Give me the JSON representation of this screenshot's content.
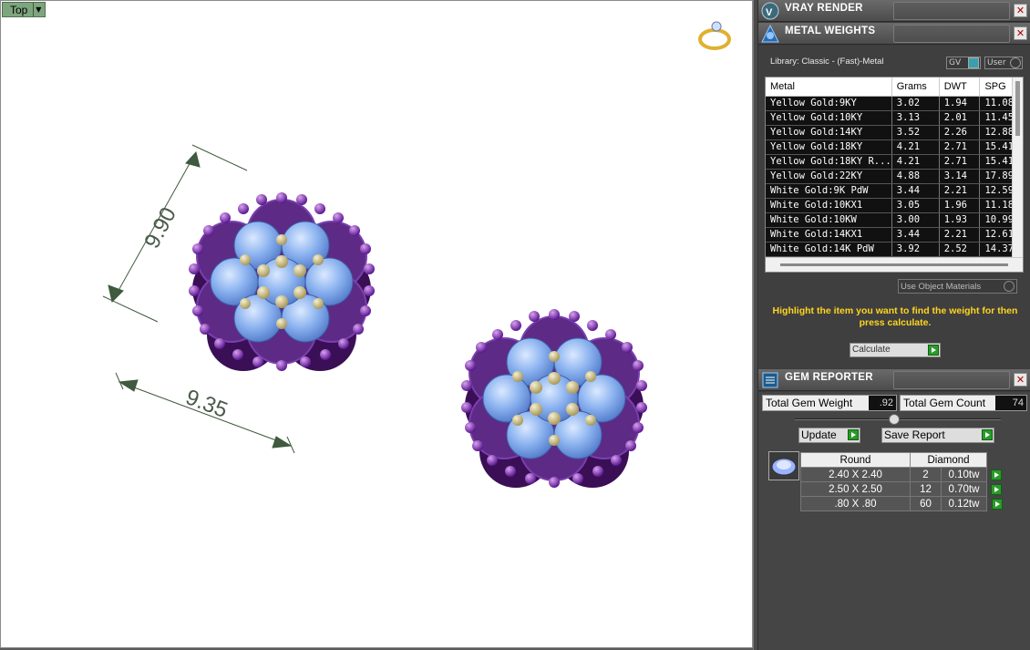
{
  "viewport": {
    "label": "Top",
    "dimensions": [
      "9.90",
      "9.35"
    ]
  },
  "panels": {
    "vray": {
      "title": "VRAY RENDER"
    },
    "metal": {
      "title": "METAL WEIGHTS",
      "library": "Library: Classic - (Fast)-Metal",
      "toggle_gv": "GV",
      "toggle_user": "User",
      "columns": [
        "Metal",
        "Grams",
        "DWT",
        "SPG"
      ],
      "rows": [
        [
          "Yellow Gold:9KY",
          "3.02",
          "1.94",
          "11.08"
        ],
        [
          "Yellow Gold:10KY",
          "3.13",
          "2.01",
          "11.45"
        ],
        [
          "Yellow Gold:14KY",
          "3.52",
          "2.26",
          "12.88"
        ],
        [
          "Yellow Gold:18KY",
          "4.21",
          "2.71",
          "15.41"
        ],
        [
          "Yellow Gold:18KY R...",
          "4.21",
          "2.71",
          "15.41"
        ],
        [
          "Yellow Gold:22KY",
          "4.88",
          "3.14",
          "17.89"
        ],
        [
          "White Gold:9K PdW",
          "3.44",
          "2.21",
          "12.59"
        ],
        [
          "White Gold:10KX1",
          "3.05",
          "1.96",
          "11.18"
        ],
        [
          "White Gold:10KW",
          "3.00",
          "1.93",
          "10.99"
        ],
        [
          "White Gold:14KX1",
          "3.44",
          "2.21",
          "12.61"
        ],
        [
          "White Gold:14K PdW",
          "3.92",
          "2.52",
          "14.37"
        ]
      ],
      "use_object_materials": "Use Object Materials",
      "hint": "Highlight the item you want to find the weight for then press calculate.",
      "calculate": "Calculate"
    },
    "gem": {
      "title": "GEM REPORTER",
      "total_weight_label": "Total Gem Weight",
      "total_weight_value": ".92",
      "total_count_label": "Total Gem Count",
      "total_count_value": "74",
      "update": "Update",
      "save_report": "Save Report",
      "shape": "Round",
      "material": "Diamond",
      "rows": [
        [
          "2.40 X 2.40",
          "2",
          "0.10tw"
        ],
        [
          "2.50 X 2.50",
          "12",
          "0.70tw"
        ],
        [
          ".80 X .80",
          "60",
          "0.12tw"
        ]
      ]
    }
  }
}
